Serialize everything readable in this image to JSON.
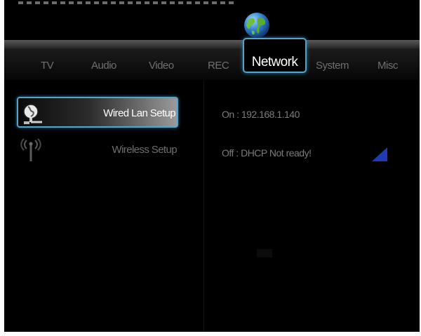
{
  "tabs": [
    {
      "label": "TV",
      "id": "tv"
    },
    {
      "label": "Audio",
      "id": "audio"
    },
    {
      "label": "Video",
      "id": "video"
    },
    {
      "label": "REC",
      "id": "rec"
    },
    {
      "label": "Network",
      "id": "network",
      "active": true
    },
    {
      "label": "System",
      "id": "system"
    },
    {
      "label": "Misc",
      "id": "misc"
    }
  ],
  "menu": {
    "items": [
      {
        "label": "Wired Lan Setup",
        "icon": "wired-lan-icon",
        "selected": true
      },
      {
        "label": "Wireless Setup",
        "icon": "wireless-antenna-icon",
        "selected": false
      }
    ]
  },
  "status": {
    "wired": "On : 192.168.1.140",
    "wireless": "Off : DHCP Not ready!"
  },
  "colors": {
    "highlight_border": "#58a2c8",
    "background": "#000000",
    "scroll_indicator": "#1c3bb5"
  }
}
